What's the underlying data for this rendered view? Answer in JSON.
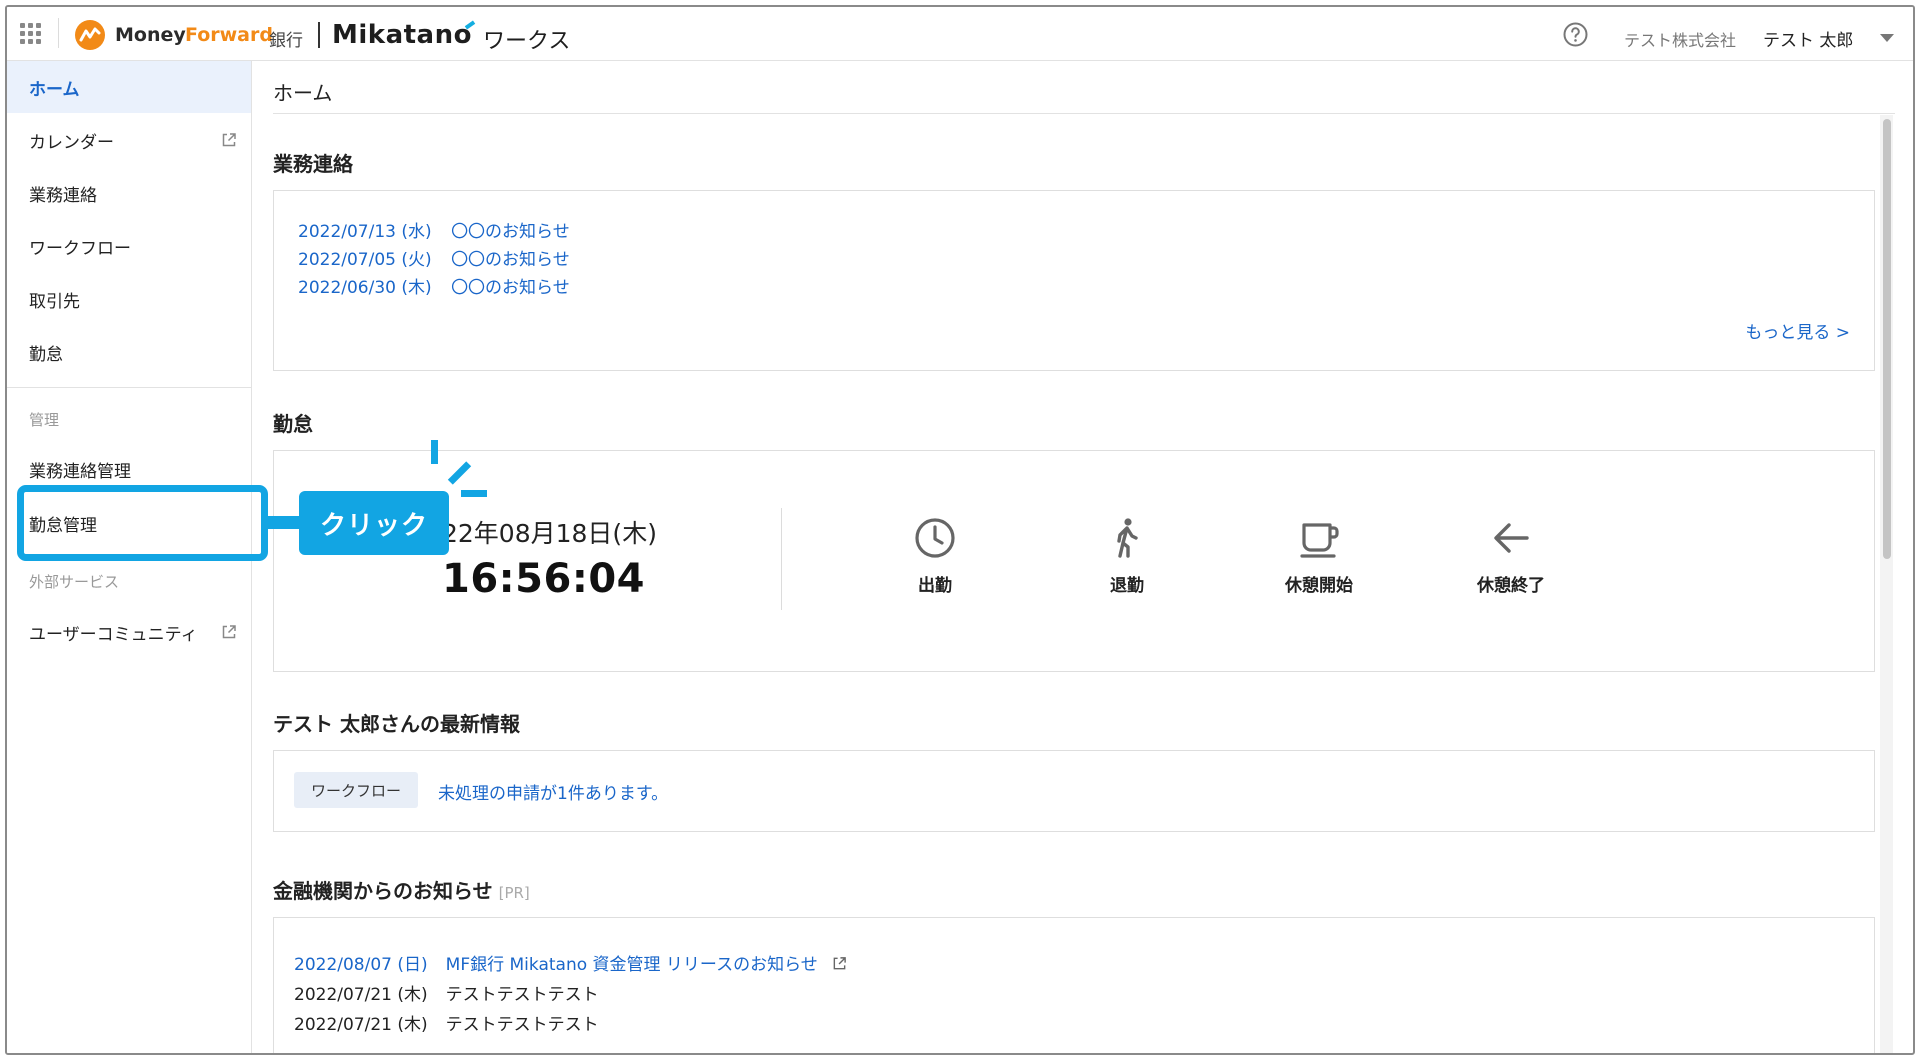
{
  "header": {
    "brand_money": "Money",
    "brand_forward": "Forward",
    "brand_bank": "銀行",
    "brand_mikatano": "Mikatano",
    "brand_works": "ワークス",
    "company": "テスト株式会社",
    "user": "テスト 太郎"
  },
  "sidebar": {
    "items": [
      {
        "label": "ホーム",
        "active": true
      },
      {
        "label": "カレンダー",
        "external": true
      },
      {
        "label": "業務連絡"
      },
      {
        "label": "ワークフロー"
      },
      {
        "label": "取引先"
      },
      {
        "label": "勤怠"
      }
    ],
    "section_admin": "管理",
    "admin_items": [
      {
        "label": "業務連絡管理"
      },
      {
        "label": "勤怠管理"
      }
    ],
    "section_external": "外部サービス",
    "external_items": [
      {
        "label": "ユーザーコミュニティ",
        "external": true
      }
    ]
  },
  "main": {
    "page_title": "ホーム",
    "notices": {
      "title": "業務連絡",
      "items": [
        {
          "date": "2022/07/13 (水)",
          "title": "〇〇のお知らせ"
        },
        {
          "date": "2022/07/05 (火)",
          "title": "〇〇のお知らせ"
        },
        {
          "date": "2022/06/30 (木)",
          "title": "〇〇のお知らせ"
        }
      ],
      "more": "もっと見る >"
    },
    "attendance": {
      "title": "勤怠",
      "date": "22年08月18日(木)",
      "time": "16:56:04",
      "buttons": [
        {
          "label": "出勤",
          "icon": "clock-icon"
        },
        {
          "label": "退勤",
          "icon": "walk-icon"
        },
        {
          "label": "休憩開始",
          "icon": "coffee-icon"
        },
        {
          "label": "休憩終了",
          "icon": "arrow-left-icon"
        }
      ]
    },
    "latest": {
      "title": "テスト 太郎さんの最新情報",
      "chip": "ワークフロー",
      "text": "未処理の申請が1件あります。"
    },
    "finance": {
      "title": "金融機関からのお知らせ",
      "pr": "[PR]",
      "items": [
        {
          "date": "2022/08/07 (日)",
          "title": "MF銀行 Mikatano 資金管理 リリースのお知らせ",
          "link": true
        },
        {
          "date": "2022/07/21 (木)",
          "title": "テストテストテスト",
          "link": false
        },
        {
          "date": "2022/07/21 (木)",
          "title": "テストテストテスト",
          "link": false
        }
      ]
    }
  },
  "annotation": {
    "callout": "クリック"
  },
  "colors": {
    "accent_blue": "#1a66c9",
    "annotation_blue": "#12a5e3",
    "brand_orange": "#f28a17",
    "active_bg": "#eaf1fc"
  }
}
